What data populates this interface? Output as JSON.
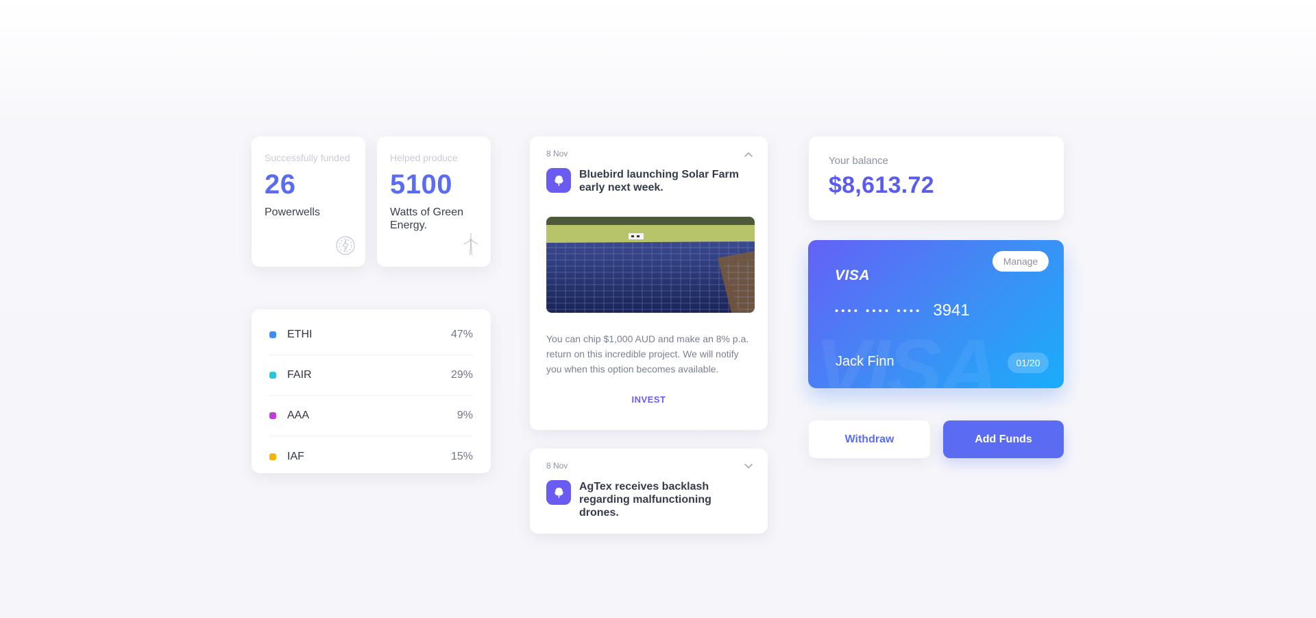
{
  "stats": [
    {
      "label": "Successfully funded",
      "value": "26",
      "sub": "Powerwells",
      "icon": "energy-icon"
    },
    {
      "label": "Helped produce",
      "value": "5100",
      "sub": "Watts of Green Energy.",
      "icon": "wind-turbine-icon"
    }
  ],
  "allocations": [
    {
      "name": "ETHI",
      "pct": "47%",
      "color": "#3d8ef5"
    },
    {
      "name": "FAIR",
      "pct": "29%",
      "color": "#2cc4d8"
    },
    {
      "name": "AAA",
      "pct": "9%",
      "color": "#c03fd6"
    },
    {
      "name": "IAF",
      "pct": "15%",
      "color": "#f5b400"
    }
  ],
  "news": [
    {
      "date": "8 Nov",
      "title": "Bluebird launching Solar Farm early next week.",
      "body": "You can chip $1,000 AUD and make an 8% p.a. return on this incredible project. We will notify you when this option becomes available.",
      "action": "INVEST",
      "expanded": true
    },
    {
      "date": "8 Nov",
      "title": "AgTex receives backlash regarding malfunctioning drones.",
      "expanded": false
    }
  ],
  "balance": {
    "label": "Your balance",
    "value": "$8,613.72"
  },
  "card": {
    "brand": "VISA",
    "manage_label": "Manage",
    "masked": "•••• •••• ••••",
    "last4": "3941",
    "holder": "Jack Finn",
    "expiry": "01/20"
  },
  "actions": {
    "withdraw": "Withdraw",
    "add_funds": "Add Funds"
  },
  "colors": {
    "accent": "#5a6cf0",
    "news_icon": "#6a5cf0"
  }
}
